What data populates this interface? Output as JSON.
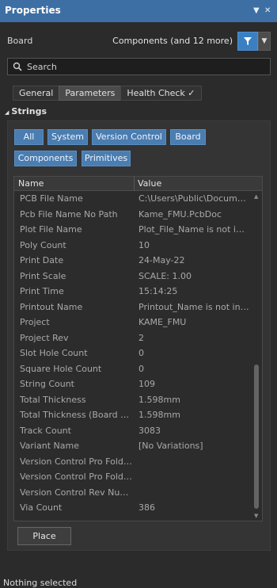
{
  "panel": {
    "title": "Properties",
    "board_label": "Board",
    "filter_text": "Components (and 12 more)",
    "search_placeholder": "Search"
  },
  "tabs": [
    {
      "label": "General"
    },
    {
      "label": "Parameters",
      "active": true
    },
    {
      "label": "Health Check ✓"
    }
  ],
  "section": {
    "title": "Strings",
    "expanded": true
  },
  "filter_chips": [
    "All",
    "System",
    "Version Control",
    "Board",
    "Components",
    "Primitives"
  ],
  "grid": {
    "columns": [
      "Name",
      "Value"
    ],
    "rows": [
      {
        "name": "PCB File Name",
        "value": "C:\\Users\\Public\\Document..."
      },
      {
        "name": "Pcb File Name No Path",
        "value": "Kame_FMU.PcbDoc"
      },
      {
        "name": "Plot File Name",
        "value": "Plot_File_Name is not inter..."
      },
      {
        "name": "Poly Count",
        "value": "10"
      },
      {
        "name": "Print Date",
        "value": "24-May-22"
      },
      {
        "name": "Print Scale",
        "value": "SCALE: 1.00"
      },
      {
        "name": "Print Time",
        "value": "15:14:25"
      },
      {
        "name": "Printout Name",
        "value": "Printout_Name is not inter..."
      },
      {
        "name": "Project",
        "value": "KAME_FMU"
      },
      {
        "name": "Project Rev",
        "value": "2"
      },
      {
        "name": "Slot Hole Count",
        "value": "0"
      },
      {
        "name": "Square Hole Count",
        "value": "0"
      },
      {
        "name": "String Count",
        "value": "109"
      },
      {
        "name": "Total Thickness",
        "value": "1.598mm"
      },
      {
        "name": "Total Thickness (Board Lay...",
        "value": "1.598mm"
      },
      {
        "name": "Track Count",
        "value": "3083"
      },
      {
        "name": "Variant Name",
        "value": "[No Variations]"
      },
      {
        "name": "Version Control Pro Folder...",
        "value": ""
      },
      {
        "name": "Version Control Pro Folder...",
        "value": ""
      },
      {
        "name": "Version Control Rev Number",
        "value": ""
      },
      {
        "name": "Via Count",
        "value": "386"
      }
    ]
  },
  "place_label": "Place",
  "status": "Nothing selected",
  "colors": {
    "titlebar": "#3d6fa4",
    "accent": "#3a7fc2",
    "chip": "#4a7db1",
    "background": "#2b2b2b"
  }
}
